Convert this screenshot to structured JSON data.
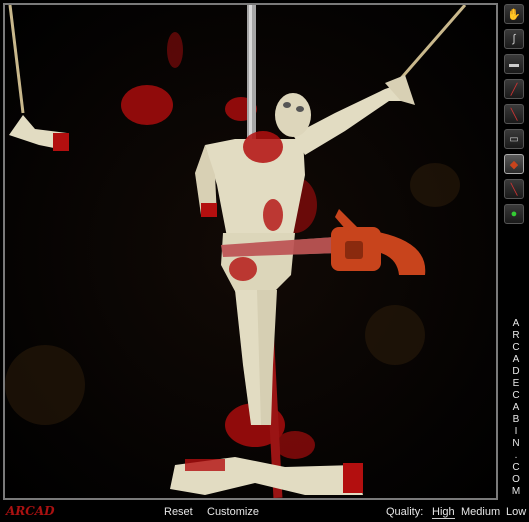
{
  "brand": {
    "letters": [
      "A",
      "R",
      "C",
      "A",
      "D",
      "E",
      "C",
      "A",
      "B",
      "I",
      "N",
      ".",
      "C",
      "O",
      "M"
    ],
    "logo_text": "ARCAD"
  },
  "toolbar": {
    "tools": [
      {
        "icon": "hand-icon",
        "selected": false
      },
      {
        "icon": "hook-icon",
        "selected": false
      },
      {
        "icon": "knife-icon",
        "selected": false
      },
      {
        "icon": "sword-icon",
        "selected": false
      },
      {
        "icon": "spear-icon",
        "selected": false
      },
      {
        "icon": "gun-icon",
        "selected": false
      },
      {
        "icon": "chainsaw-icon",
        "selected": true
      },
      {
        "icon": "dagger-icon",
        "selected": false
      },
      {
        "icon": "grenade-icon",
        "selected": false
      }
    ]
  },
  "bottombar": {
    "reset": "Reset",
    "customize": "Customize",
    "quality_label": "Quality:",
    "quality_high": "High",
    "quality_medium": "Medium",
    "quality_low": "Low",
    "quality_selected": "High"
  },
  "colors": {
    "blood": "#b30f0f",
    "skin": "#e2dcc2",
    "chainsaw": "#c8441c",
    "pole": "#a0a0a0",
    "rope": "#c9b88c"
  }
}
